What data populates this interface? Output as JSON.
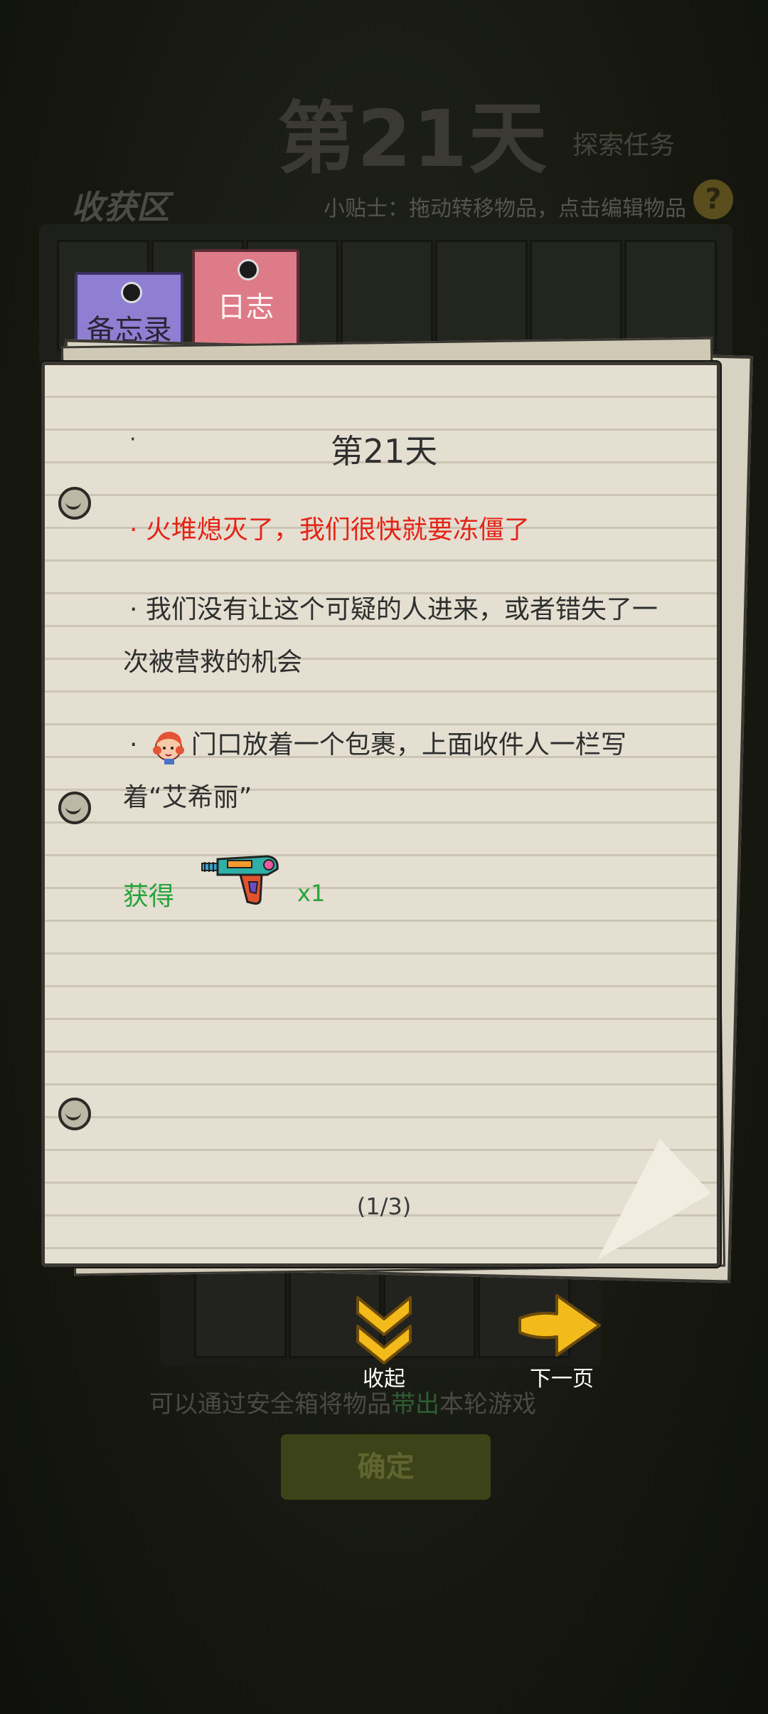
{
  "background": {
    "day_title": "第21天",
    "task_label": "探索任务",
    "harvest_zone": "收获区",
    "tip": "小贴士：拖动转移物品，点击编辑物品",
    "help_symbol": "?",
    "hint_before": "可以通过安全箱将物品",
    "hint_highlight": "带出",
    "hint_after": "本轮游戏",
    "confirm_label": "确定"
  },
  "tabs": [
    {
      "label": "备忘录",
      "color": "#8e7fd3"
    },
    {
      "label": "日志",
      "color": "#de7b88"
    }
  ],
  "journal": {
    "heading": "第21天",
    "bullet": "·",
    "entries": [
      {
        "text": "火堆熄灭了，我们很快就要冻僵了",
        "color": "#e52416"
      },
      {
        "text": "我们没有让这个可疑的人进来，或者错失了一次被营救的机会"
      },
      {
        "text_before": "",
        "text_after": "门口放着一个包裹，上面收件人一栏写着“艾希丽”",
        "icon": "character-avatar-icon"
      }
    ],
    "reward_label": "获得",
    "reward_item_icon": "toy-blaster-gun-icon",
    "reward_count": "x1",
    "pager": "(1/3)"
  },
  "buttons": {
    "collapse_label": "收起",
    "next_label": "下一页"
  },
  "colors": {
    "accent_green": "#26a43b",
    "alert_red": "#e52416",
    "button_yellow": "#f2bb1b"
  }
}
